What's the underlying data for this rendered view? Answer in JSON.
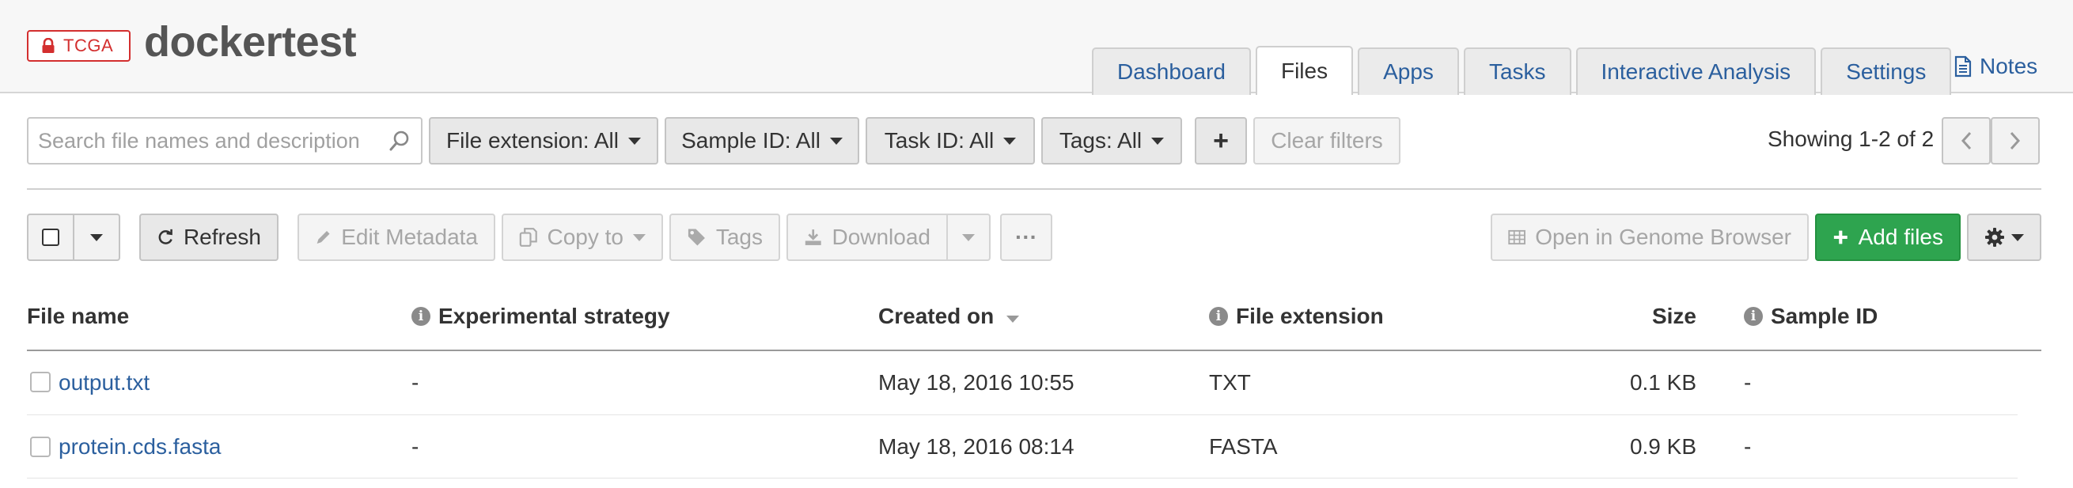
{
  "header": {
    "badge": "TCGA",
    "title": "dockertest",
    "tabs": [
      {
        "label": "Dashboard"
      },
      {
        "label": "Files"
      },
      {
        "label": "Apps"
      },
      {
        "label": "Tasks"
      },
      {
        "label": "Interactive Analysis"
      },
      {
        "label": "Settings"
      }
    ],
    "active_tab": "Files",
    "notes": "Notes"
  },
  "filters": {
    "search_placeholder": "Search file names and description",
    "file_extension": "File extension: All",
    "sample_id": "Sample ID: All",
    "task_id": "Task ID: All",
    "tags": "Tags: All",
    "add": "+",
    "clear": "Clear filters",
    "showing": "Showing 1-2 of 2"
  },
  "toolbar": {
    "refresh": "Refresh",
    "edit_metadata": "Edit Metadata",
    "copy_to": "Copy to",
    "tags": "Tags",
    "download": "Download",
    "more": "···",
    "genome_browser": "Open in Genome Browser",
    "add_files": "Add files"
  },
  "table": {
    "columns": [
      {
        "label": "File name"
      },
      {
        "label": "Experimental strategy"
      },
      {
        "label": "Created on"
      },
      {
        "label": "File extension"
      },
      {
        "label": "Size"
      },
      {
        "label": "Sample ID"
      }
    ],
    "rows": [
      {
        "name": "output.txt",
        "strategy": "-",
        "created": "May 18, 2016 10:55",
        "extension": "TXT",
        "size": "0.1 KB",
        "sample": "-"
      },
      {
        "name": "protein.cds.fasta",
        "strategy": "-",
        "created": "May 18, 2016 08:14",
        "extension": "FASTA",
        "size": "0.9 KB",
        "sample": "-"
      }
    ]
  },
  "colors": {
    "link": "#2b5f9e",
    "badge_red": "#d32f2f",
    "add_green": "#2ea44f"
  },
  "icons": [
    "lock-icon",
    "document-icon",
    "search-icon",
    "refresh-icon",
    "pencil-icon",
    "copy-icon",
    "tag-icon",
    "download-icon",
    "table-icon",
    "plus-icon",
    "gear-icon",
    "chevron-left-icon",
    "chevron-right-icon",
    "info-icon",
    "sort-down-icon"
  ]
}
